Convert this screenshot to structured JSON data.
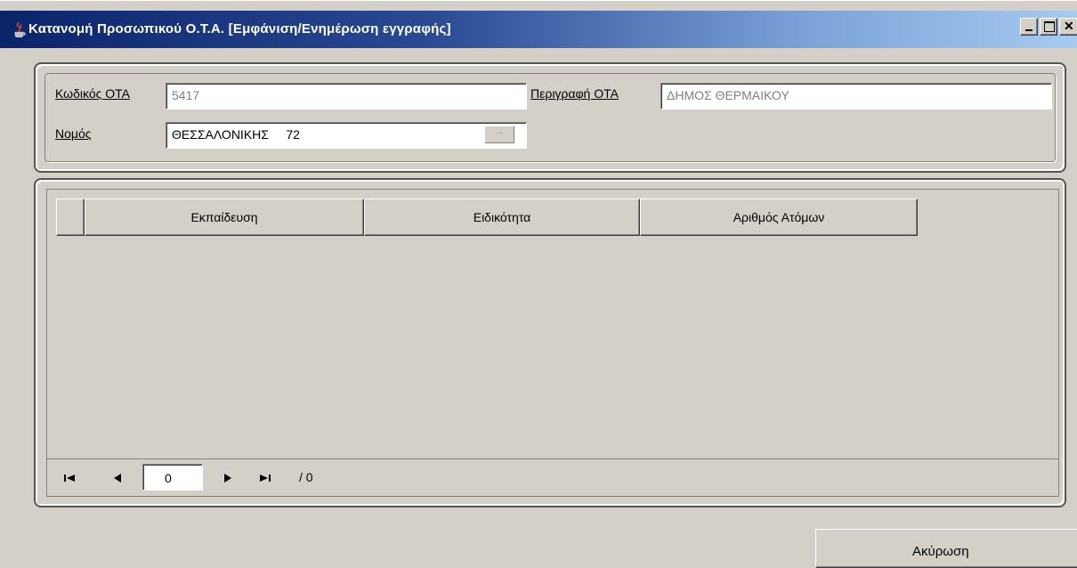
{
  "window": {
    "title": "Κατανομή Προσωπικού Ο.Τ.Α. [Εμφάνιση/Ενημέρωση εγγραφής]"
  },
  "header": {
    "code_label": "Κωδικός ΟΤΑ",
    "code_value": "5417",
    "description_label": "Περιγραφή ΟΤΑ",
    "description_value": "ΔΗΜΟΣ ΘΕΡΜΑΙΚΟΥ",
    "prefecture_label": "Νομός",
    "prefecture_value": "ΘΕΣΣΑΛΟΝΙΚΗΣ     72",
    "lookup_button": "..."
  },
  "grid": {
    "columns": [
      "Εκπαίδευση",
      "Ειδικότητα",
      "Αριθμός Ατόμων"
    ],
    "rows": []
  },
  "navigator": {
    "current_page": "0",
    "total": "/ 0"
  },
  "footer": {
    "cancel_label": "Ακύρωση"
  }
}
